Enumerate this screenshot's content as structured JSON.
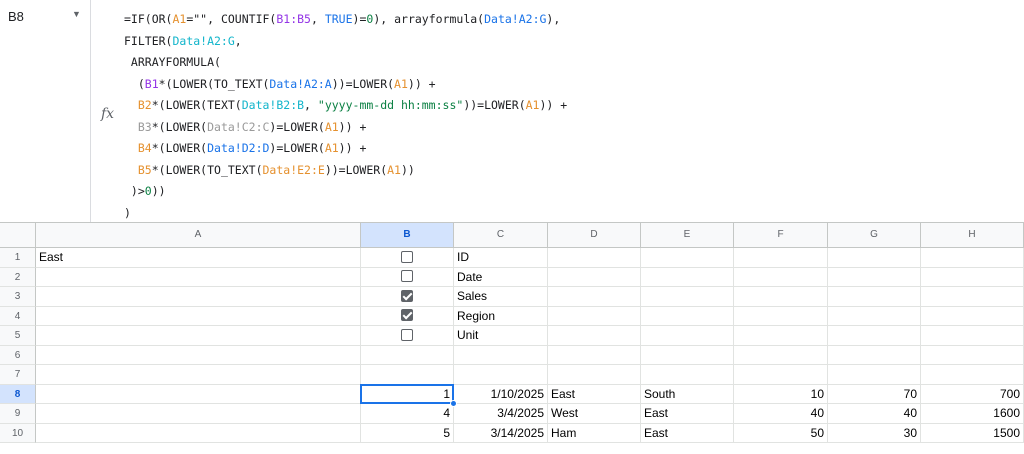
{
  "name_box": {
    "value": "B8"
  },
  "formula_bar": {
    "fx_symbol": "fx",
    "lines": [
      [
        [
          "=IF(OR(",
          ""
        ],
        [
          "A1",
          "c-a1"
        ],
        [
          "=\"\", COUNTIF(",
          ""
        ],
        [
          "B1:B5",
          "c-b1"
        ],
        [
          ", ",
          ""
        ],
        [
          "TRUE",
          "c-bool"
        ],
        [
          ")=",
          ""
        ],
        [
          "0",
          "c-num"
        ],
        [
          "), arrayformula(",
          ""
        ],
        [
          "Data!A2:G",
          "c-dataA"
        ],
        [
          "),",
          ""
        ]
      ],
      [
        [
          "FILTER(",
          ""
        ],
        [
          "Data!A2:G",
          "c-dataB"
        ],
        [
          ",",
          ""
        ]
      ],
      [
        [
          " ARRAYFORMULA(",
          ""
        ]
      ],
      [
        [
          "  (",
          ""
        ],
        [
          "B1",
          "c-b1"
        ],
        [
          "*(LOWER(TO_TEXT(",
          ""
        ],
        [
          "Data!A2:A",
          "c-dataA"
        ],
        [
          "))=LOWER(",
          ""
        ],
        [
          "A1",
          "c-a1"
        ],
        [
          ")) +",
          ""
        ]
      ],
      [
        [
          "  ",
          ""
        ],
        [
          "B2",
          "c-b2"
        ],
        [
          "*(LOWER(TEXT(",
          ""
        ],
        [
          "Data!B2:B",
          "c-dataB"
        ],
        [
          ", ",
          ""
        ],
        [
          "\"yyyy-mm-dd hh:mm:ss\"",
          "c-str"
        ],
        [
          "))=LOWER(",
          ""
        ],
        [
          "A1",
          "c-a1"
        ],
        [
          ")) +",
          ""
        ]
      ],
      [
        [
          "  ",
          ""
        ],
        [
          "B3",
          "c-b3"
        ],
        [
          "*(LOWER(",
          ""
        ],
        [
          "Data!C2:C",
          "c-dataC"
        ],
        [
          ")=LOWER(",
          ""
        ],
        [
          "A1",
          "c-a1"
        ],
        [
          ")) +",
          ""
        ]
      ],
      [
        [
          "  ",
          ""
        ],
        [
          "B4",
          "c-b4"
        ],
        [
          "*(LOWER(",
          ""
        ],
        [
          "Data!D2:D",
          "c-dataD"
        ],
        [
          ")=LOWER(",
          ""
        ],
        [
          "A1",
          "c-a1"
        ],
        [
          ")) +",
          ""
        ]
      ],
      [
        [
          "  ",
          ""
        ],
        [
          "B5",
          "c-b5"
        ],
        [
          "*(LOWER(TO_TEXT(",
          ""
        ],
        [
          "Data!E2:E",
          "c-dataE"
        ],
        [
          "))=LOWER(",
          ""
        ],
        [
          "A1",
          "c-a1"
        ],
        [
          "))",
          ""
        ]
      ],
      [
        [
          " )>",
          ""
        ],
        [
          "0",
          "c-num"
        ],
        [
          "))",
          ""
        ]
      ],
      [
        [
          ")",
          ""
        ]
      ]
    ]
  },
  "columns": [
    {
      "id": "A",
      "label": "A"
    },
    {
      "id": "B",
      "label": "B",
      "selected": true
    },
    {
      "id": "C",
      "label": "C"
    },
    {
      "id": "D",
      "label": "D"
    },
    {
      "id": "E",
      "label": "E"
    },
    {
      "id": "F",
      "label": "F"
    },
    {
      "id": "G",
      "label": "G"
    },
    {
      "id": "H",
      "label": "H"
    }
  ],
  "rows": [
    {
      "n": "1",
      "cells": {
        "A": "East",
        "B": {
          "checkbox": false
        },
        "C": "ID"
      }
    },
    {
      "n": "2",
      "cells": {
        "B": {
          "checkbox": false
        },
        "C": "Date"
      }
    },
    {
      "n": "3",
      "cells": {
        "B": {
          "checkbox": true
        },
        "C": "Sales"
      }
    },
    {
      "n": "4",
      "cells": {
        "B": {
          "checkbox": true
        },
        "C": "Region"
      }
    },
    {
      "n": "5",
      "cells": {
        "B": {
          "checkbox": false
        },
        "C": "Unit"
      }
    },
    {
      "n": "6",
      "cells": {}
    },
    {
      "n": "7",
      "cells": {}
    },
    {
      "n": "8",
      "selected": true,
      "cells": {
        "B": {
          "num": "1"
        },
        "C": {
          "num": "1/10/2025"
        },
        "D": "East",
        "E": "South",
        "F": {
          "num": "10"
        },
        "G": {
          "num": "70"
        },
        "H": {
          "num": "700"
        }
      }
    },
    {
      "n": "9",
      "cells": {
        "B": {
          "num": "4"
        },
        "C": {
          "num": "3/4/2025"
        },
        "D": "West",
        "E": "East",
        "F": {
          "num": "40"
        },
        "G": {
          "num": "40"
        },
        "H": {
          "num": "1600"
        }
      }
    },
    {
      "n": "10",
      "cells": {
        "B": {
          "num": "5"
        },
        "C": {
          "num": "3/14/2025"
        },
        "D": "Ham",
        "E": "East",
        "F": {
          "num": "50"
        },
        "G": {
          "num": "30"
        },
        "H": {
          "num": "1500"
        }
      }
    }
  ],
  "active_cell": "B8"
}
